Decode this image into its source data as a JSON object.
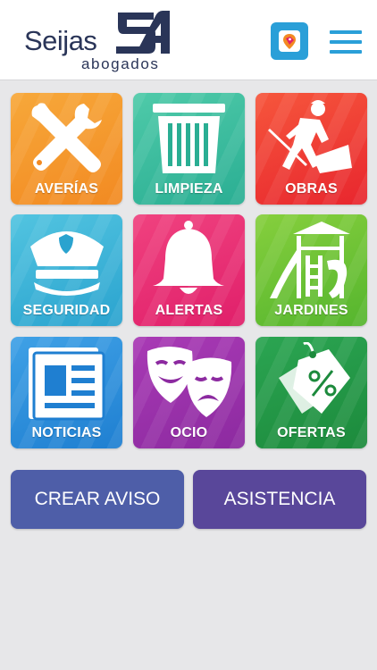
{
  "header": {
    "logo_word": "Seijas",
    "logo_monogram": "SA",
    "logo_sub": "abogados",
    "app_badge_icon": "map-pin-tag-icon",
    "menu_icon": "hamburger-menu-icon",
    "brand_color": "#2a3558",
    "accent_color": "#2a9fd8"
  },
  "tiles": [
    {
      "label": "AVERÍAS",
      "icon": "wrench-screwdriver-icon",
      "color": "#f28a22"
    },
    {
      "label": "LIMPIEZA",
      "icon": "trash-bin-icon",
      "color": "#2aae93"
    },
    {
      "label": "OBRAS",
      "icon": "construction-worker-icon",
      "color": "#e8262e"
    },
    {
      "label": "SEGURIDAD",
      "icon": "police-cap-icon",
      "color": "#2aa3cf"
    },
    {
      "label": "ALERTAS",
      "icon": "bell-icon",
      "color": "#e01f6a"
    },
    {
      "label": "JARDINES",
      "icon": "playground-icon",
      "color": "#55b52e"
    },
    {
      "label": "NOTICIAS",
      "icon": "newspaper-icon",
      "color": "#1f7fd1"
    },
    {
      "label": "OCIO",
      "icon": "theater-masks-icon",
      "color": "#8c2aa0"
    },
    {
      "label": "OFERTAS",
      "icon": "discount-tag-icon",
      "color": "#1c8a3c"
    }
  ],
  "actions": {
    "crear_aviso": "CREAR AVISO",
    "asistencia": "ASISTENCIA"
  }
}
